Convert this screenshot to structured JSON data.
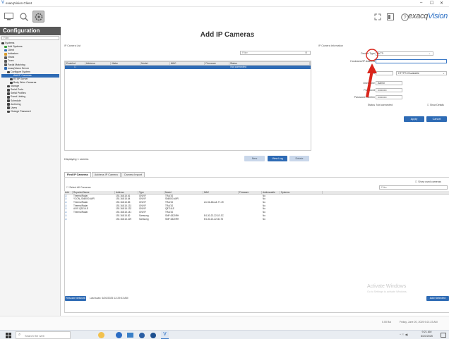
{
  "window": {
    "title": "exacqVision Client",
    "minimize": "–",
    "maximize": "☐",
    "close": "✕"
  },
  "toolbar": {
    "brand_prefix": "exacq",
    "brand_suffix": "Vision"
  },
  "sidebar": {
    "title": "Configuration",
    "filter_placeholder": "Filter",
    "items": [
      {
        "label": "Systems",
        "indent": 0,
        "color": "#3c3c3c"
      },
      {
        "label": "Add Systems",
        "indent": 1,
        "color": "#3a9d3a"
      },
      {
        "label": "Client",
        "indent": 1,
        "color": "#2e6bb5"
      },
      {
        "label": "Indicators",
        "indent": 1,
        "color": "#d69a2a"
      },
      {
        "label": "Views",
        "indent": 1,
        "color": "#5a5a5a"
      },
      {
        "label": "Tours",
        "indent": 1,
        "color": "#5a5a5a"
      },
      {
        "label": "Facial Matching",
        "indent": 1,
        "color": "#5a5a5a"
      },
      {
        "label": "exacqVision Server",
        "indent": 1,
        "color": "#2e6bb5"
      },
      {
        "label": "Configure System",
        "indent": 2,
        "color": "#444"
      },
      {
        "label": "Add IP Cameras",
        "indent": 3,
        "color": "#2e6bb5",
        "selected": true
      },
      {
        "label": "RTSP Server",
        "indent": 3,
        "color": "#444"
      },
      {
        "label": "Body Worn Cameras",
        "indent": 3,
        "color": "#444"
      },
      {
        "label": "Storage",
        "indent": 2,
        "color": "#444"
      },
      {
        "label": "Serial Ports",
        "indent": 2,
        "color": "#444"
      },
      {
        "label": "Serial Profiles",
        "indent": 2,
        "color": "#444"
      },
      {
        "label": "Event Linking",
        "indent": 2,
        "color": "#444"
      },
      {
        "label": "Schedule",
        "indent": 2,
        "color": "#444"
      },
      {
        "label": "Archiving",
        "indent": 2,
        "color": "#444"
      },
      {
        "label": "Users",
        "indent": 2,
        "color": "#444"
      },
      {
        "label": "Change Password",
        "indent": 2,
        "color": "#444"
      }
    ]
  },
  "main": {
    "title": "Add IP Cameras",
    "camera_list_label": "IP Camera List",
    "filter_placeholder": "Filter",
    "columns": [
      "Enabled",
      "Address",
      "Make",
      "Model",
      "MAC",
      "Firmware",
      "Status"
    ],
    "row": {
      "status": "Not connected"
    },
    "displaying": "Displaying 1 camera",
    "buttons": {
      "new": "New",
      "view_log": "View Log",
      "delete": "Delete"
    }
  },
  "camera_info": {
    "label": "IP Camera Information",
    "device_type_label": "Device Type",
    "device_type_value": "ACTi",
    "hostname_label": "Hostname/IP Address",
    "hostname_value": "",
    "port_label": "Port",
    "protocol_value": "HTTPS if Available",
    "username_label": "Username",
    "username_value": "Admin",
    "password_label": "Password",
    "password_value": "••••••••••",
    "password_confirm_label": "Password Confirm",
    "password_confirm_value": "••••••••••",
    "status_label": "Status",
    "status_value": "Not connected",
    "show_details": "Show Details",
    "apply": "Apply",
    "cancel": "Cancel"
  },
  "find": {
    "tabs": [
      "Find IP Cameras",
      "Address IP Camera",
      "Camera Import"
    ],
    "show_used": "Show used cameras",
    "select_all": "Select All Cameras",
    "filter_placeholder": "Filter",
    "columns": [
      "Add",
      "Reported Name",
      "Address",
      "Type",
      "Model",
      "MAC",
      "Firmware",
      "Addressable",
      "Systems"
    ],
    "rows": [
      {
        "name": "ThermalRadar",
        "address": "192.168.15.61",
        "type": "ONVIF",
        "model": "TRA/1S",
        "mac": "",
        "addressable": "No"
      },
      {
        "name": "YCON_SN8000-WIR",
        "address": "192.168.15.64",
        "type": "ONVIF",
        "model": "SN8000-WIR",
        "mac": "",
        "addressable": "No"
      },
      {
        "name": "ThermalRadar",
        "address": "192.168.15.85",
        "type": "ONVIF",
        "model": "TRA/1S",
        "mac": "A1-9A-86-A4-77-49",
        "addressable": "No"
      },
      {
        "name": "ThermalRadar",
        "address": "192.168.15.131",
        "type": "ONVIF",
        "model": "TRA/1S",
        "mac": "",
        "addressable": "No"
      },
      {
        "name": "AXIS Q9216-E",
        "address": "192.168.15.132",
        "type": "ONVIF",
        "model": "Q8716-E",
        "mac": "",
        "addressable": "No"
      },
      {
        "name": "ThermalRadar",
        "address": "192.168.15.141",
        "type": "ONVIF",
        "model": "TRA/1S",
        "mac": "",
        "addressable": "No"
      },
      {
        "name": "",
        "address": "192.168.15.82",
        "type": "Samsung",
        "model": "SNP-6320RH",
        "mac": "E4-30-22-22-1E-3C",
        "addressable": "No"
      },
      {
        "name": "",
        "address": "192.168.15.229",
        "type": "Samsung",
        "model": "SNP-6320RH",
        "mac": "E4-30-22-22-30-78",
        "addressable": "No"
      }
    ],
    "rescan": "Rescan Network",
    "last_scan": "Last scan: 6/20/2025 12:29:43 AM",
    "add_selected": "Add Selected"
  },
  "status_bar": {
    "rate": "0.00 B/s",
    "datetime": "Friday, June 20, 2025   9:21:23 AM"
  },
  "watermark": {
    "line1": "Activate Windows",
    "line2": "Go to Settings to activate Windows."
  },
  "taskbar": {
    "search_placeholder": "Search the web",
    "clock_time": "9:21 AM",
    "clock_date": "6/20/2025"
  }
}
